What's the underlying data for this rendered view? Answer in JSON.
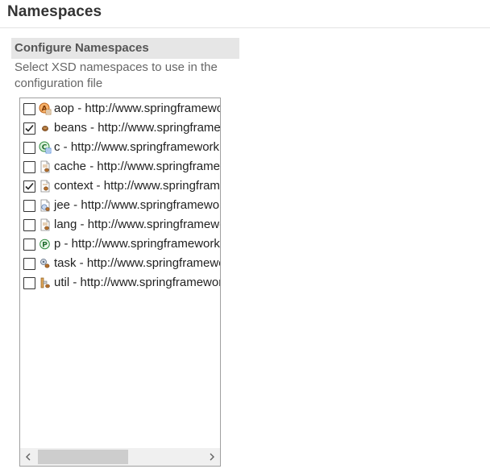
{
  "page": {
    "title": "Namespaces"
  },
  "section": {
    "title": "Configure Namespaces",
    "description": "Select XSD namespaces to use in the configuration file"
  },
  "namespaces": [
    {
      "label": "aop - http://www.springframework.org/schema/aop",
      "checked": false,
      "icon": "aop-icon"
    },
    {
      "label": "beans - http://www.springframework.org/schema/beans",
      "checked": true,
      "icon": "beans-icon"
    },
    {
      "label": "c - http://www.springframework.org/schema/c",
      "checked": false,
      "icon": "c-namespace-icon"
    },
    {
      "label": "cache - http://www.springframework.org/schema/cache",
      "checked": false,
      "icon": "cache-icon"
    },
    {
      "label": "context - http://www.springframework.org/schema/context",
      "checked": true,
      "icon": "context-icon"
    },
    {
      "label": "jee - http://www.springframework.org/schema/jee",
      "checked": false,
      "icon": "jee-icon"
    },
    {
      "label": "lang - http://www.springframework.org/schema/lang",
      "checked": false,
      "icon": "lang-icon"
    },
    {
      "label": "p - http://www.springframework.org/schema/p",
      "checked": false,
      "icon": "p-namespace-icon"
    },
    {
      "label": "task - http://www.springframework.org/schema/task",
      "checked": false,
      "icon": "task-icon"
    },
    {
      "label": "util - http://www.springframework.org/schema/util",
      "checked": false,
      "icon": "util-icon"
    }
  ],
  "scrollbar": {
    "left_arrow": "‹",
    "right_arrow": "›"
  }
}
